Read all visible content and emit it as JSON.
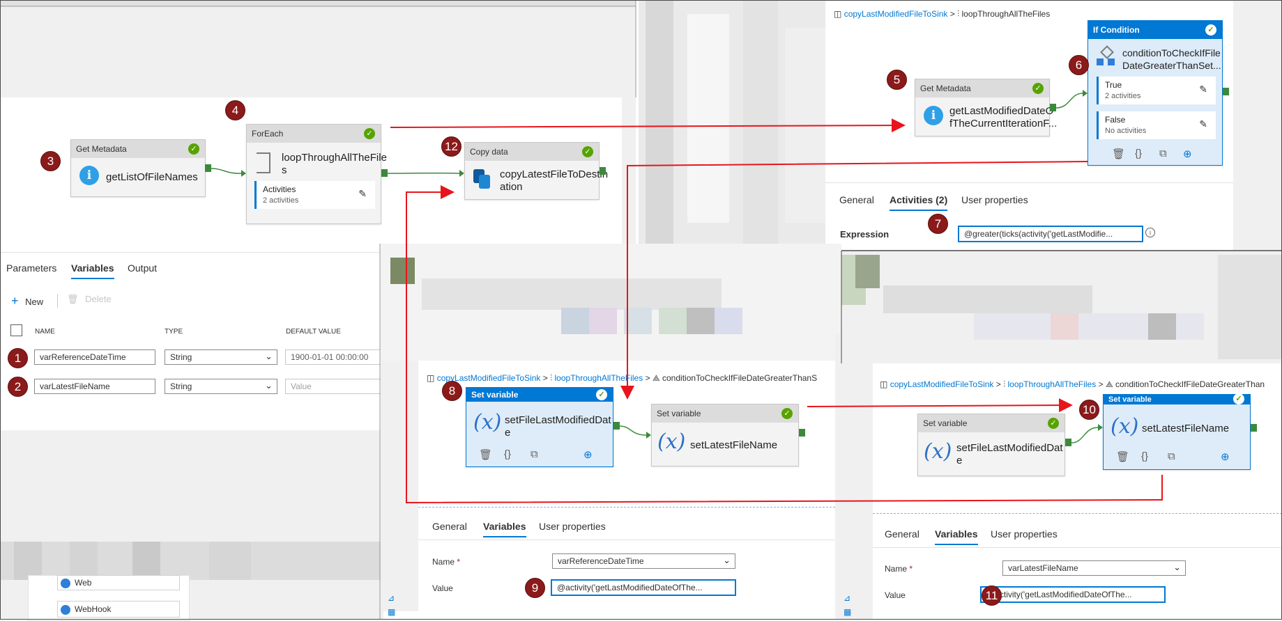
{
  "pipeline": {
    "get_metadata": {
      "type": "Get Metadata",
      "name": "getListOfFileNames"
    },
    "foreach": {
      "type": "ForEach",
      "name_line1": "loopThroughAllTheFile",
      "name_line2": "s",
      "sub_title": "Activities",
      "sub_count": "2 activities"
    },
    "copy": {
      "type": "Copy data",
      "name_line1": "copyLatestFileToDestin",
      "name_line2": "ation"
    }
  },
  "pipeline_tabs": [
    "Parameters",
    "Variables",
    "Output"
  ],
  "variables_toolbar": {
    "new": "New",
    "delete": "Delete"
  },
  "variables_table": {
    "headers": {
      "name": "NAME",
      "type": "TYPE",
      "default": "DEFAULT VALUE"
    },
    "rows": [
      {
        "name": "varReferenceDateTime",
        "type": "String",
        "default": "1900-01-01 00:00:00"
      },
      {
        "name": "varLatestFileName",
        "type": "String",
        "default": "Value"
      }
    ]
  },
  "toolbox": {
    "web": "Web",
    "webhook": "WebHook"
  },
  "foreach_view": {
    "breadcrumb": {
      "root": "copyLastModifiedFileToSink",
      "sep": ">",
      "child": "loopThroughAllTheFiles"
    },
    "get_metadata": {
      "type": "Get Metadata",
      "name_line1": "getLastModifiedDateO",
      "name_line2": "fTheCurrentIterationF..."
    },
    "if_condition": {
      "type": "If Condition",
      "name_line1": "conditionToCheckIfFile",
      "name_line2": "DateGreaterThanSet...",
      "true_label": "True",
      "true_count": "2 activities",
      "false_label": "False",
      "false_count": "No activities"
    },
    "tabs": [
      "General",
      "Activities (2)",
      "User properties"
    ],
    "expression_label": "Expression",
    "expression_value": "@greater(ticks(activity('getLastModifie..."
  },
  "true_view_a": {
    "breadcrumb": {
      "root": "copyLastModifiedFileToSink",
      "child": "loopThroughAllTheFiles",
      "leaf": "conditionToCheckIfFileDateGreaterThanS"
    },
    "set1": {
      "type": "Set variable",
      "name_line1": "setFileLastModifiedDat",
      "name_line2": "e"
    },
    "set2": {
      "type": "Set variable",
      "name": "setLatestFileName"
    },
    "tabs": [
      "General",
      "Variables",
      "User properties"
    ],
    "name_label": "Name",
    "required": "*",
    "name_value": "varReferenceDateTime",
    "value_label": "Value",
    "value_value": "@activity('getLastModifiedDateOfThe..."
  },
  "true_view_b": {
    "breadcrumb": {
      "root": "copyLastModifiedFileToSink",
      "child": "loopThroughAllTheFiles",
      "leaf": "conditionToCheckIfFileDateGreaterThan"
    },
    "set1": {
      "type": "Set variable",
      "name_line1": "setFileLastModifiedDat",
      "name_line2": "e"
    },
    "set2": {
      "type": "Set variable",
      "name": "setLatestFileName"
    },
    "tabs": [
      "General",
      "Variables",
      "User properties"
    ],
    "name_label": "Name",
    "required": "*",
    "name_value": "varLatestFileName",
    "value_label": "Value",
    "value_value": "@activity('getLastModifiedDateOfThe..."
  },
  "badges": [
    "1",
    "2",
    "3",
    "4",
    "5",
    "6",
    "7",
    "8",
    "9",
    "10",
    "11",
    "12"
  ],
  "colors": {
    "accent": "#0078d4",
    "success": "#57a300",
    "badge": "#8b1a1a",
    "arrow": "#e8141b"
  }
}
